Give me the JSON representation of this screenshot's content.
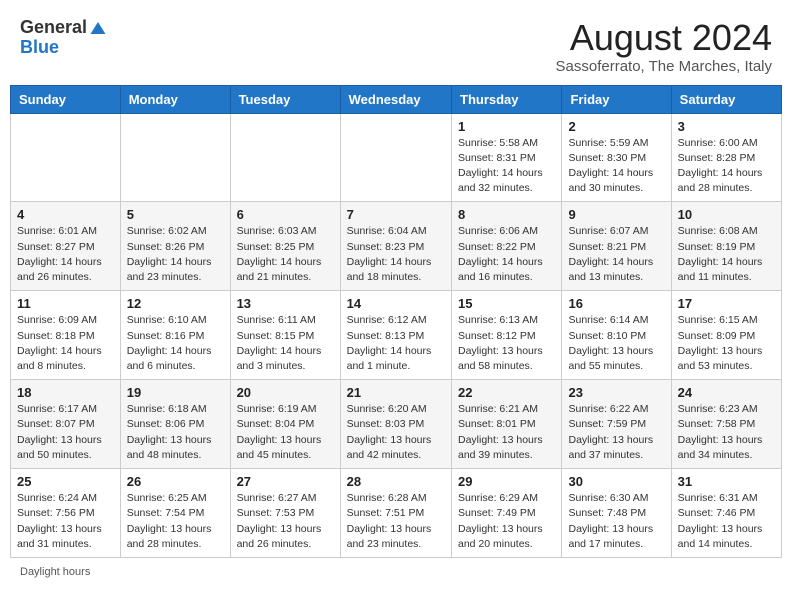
{
  "header": {
    "logo_general": "General",
    "logo_blue": "Blue",
    "month_title": "August 2024",
    "subtitle": "Sassoferrato, The Marches, Italy"
  },
  "days_of_week": [
    "Sunday",
    "Monday",
    "Tuesday",
    "Wednesday",
    "Thursday",
    "Friday",
    "Saturday"
  ],
  "weeks": [
    [
      {
        "day": "",
        "info": ""
      },
      {
        "day": "",
        "info": ""
      },
      {
        "day": "",
        "info": ""
      },
      {
        "day": "",
        "info": ""
      },
      {
        "day": "1",
        "info": "Sunrise: 5:58 AM\nSunset: 8:31 PM\nDaylight: 14 hours\nand 32 minutes."
      },
      {
        "day": "2",
        "info": "Sunrise: 5:59 AM\nSunset: 8:30 PM\nDaylight: 14 hours\nand 30 minutes."
      },
      {
        "day": "3",
        "info": "Sunrise: 6:00 AM\nSunset: 8:28 PM\nDaylight: 14 hours\nand 28 minutes."
      }
    ],
    [
      {
        "day": "4",
        "info": "Sunrise: 6:01 AM\nSunset: 8:27 PM\nDaylight: 14 hours\nand 26 minutes."
      },
      {
        "day": "5",
        "info": "Sunrise: 6:02 AM\nSunset: 8:26 PM\nDaylight: 14 hours\nand 23 minutes."
      },
      {
        "day": "6",
        "info": "Sunrise: 6:03 AM\nSunset: 8:25 PM\nDaylight: 14 hours\nand 21 minutes."
      },
      {
        "day": "7",
        "info": "Sunrise: 6:04 AM\nSunset: 8:23 PM\nDaylight: 14 hours\nand 18 minutes."
      },
      {
        "day": "8",
        "info": "Sunrise: 6:06 AM\nSunset: 8:22 PM\nDaylight: 14 hours\nand 16 minutes."
      },
      {
        "day": "9",
        "info": "Sunrise: 6:07 AM\nSunset: 8:21 PM\nDaylight: 14 hours\nand 13 minutes."
      },
      {
        "day": "10",
        "info": "Sunrise: 6:08 AM\nSunset: 8:19 PM\nDaylight: 14 hours\nand 11 minutes."
      }
    ],
    [
      {
        "day": "11",
        "info": "Sunrise: 6:09 AM\nSunset: 8:18 PM\nDaylight: 14 hours\nand 8 minutes."
      },
      {
        "day": "12",
        "info": "Sunrise: 6:10 AM\nSunset: 8:16 PM\nDaylight: 14 hours\nand 6 minutes."
      },
      {
        "day": "13",
        "info": "Sunrise: 6:11 AM\nSunset: 8:15 PM\nDaylight: 14 hours\nand 3 minutes."
      },
      {
        "day": "14",
        "info": "Sunrise: 6:12 AM\nSunset: 8:13 PM\nDaylight: 14 hours\nand 1 minute."
      },
      {
        "day": "15",
        "info": "Sunrise: 6:13 AM\nSunset: 8:12 PM\nDaylight: 13 hours\nand 58 minutes."
      },
      {
        "day": "16",
        "info": "Sunrise: 6:14 AM\nSunset: 8:10 PM\nDaylight: 13 hours\nand 55 minutes."
      },
      {
        "day": "17",
        "info": "Sunrise: 6:15 AM\nSunset: 8:09 PM\nDaylight: 13 hours\nand 53 minutes."
      }
    ],
    [
      {
        "day": "18",
        "info": "Sunrise: 6:17 AM\nSunset: 8:07 PM\nDaylight: 13 hours\nand 50 minutes."
      },
      {
        "day": "19",
        "info": "Sunrise: 6:18 AM\nSunset: 8:06 PM\nDaylight: 13 hours\nand 48 minutes."
      },
      {
        "day": "20",
        "info": "Sunrise: 6:19 AM\nSunset: 8:04 PM\nDaylight: 13 hours\nand 45 minutes."
      },
      {
        "day": "21",
        "info": "Sunrise: 6:20 AM\nSunset: 8:03 PM\nDaylight: 13 hours\nand 42 minutes."
      },
      {
        "day": "22",
        "info": "Sunrise: 6:21 AM\nSunset: 8:01 PM\nDaylight: 13 hours\nand 39 minutes."
      },
      {
        "day": "23",
        "info": "Sunrise: 6:22 AM\nSunset: 7:59 PM\nDaylight: 13 hours\nand 37 minutes."
      },
      {
        "day": "24",
        "info": "Sunrise: 6:23 AM\nSunset: 7:58 PM\nDaylight: 13 hours\nand 34 minutes."
      }
    ],
    [
      {
        "day": "25",
        "info": "Sunrise: 6:24 AM\nSunset: 7:56 PM\nDaylight: 13 hours\nand 31 minutes."
      },
      {
        "day": "26",
        "info": "Sunrise: 6:25 AM\nSunset: 7:54 PM\nDaylight: 13 hours\nand 28 minutes."
      },
      {
        "day": "27",
        "info": "Sunrise: 6:27 AM\nSunset: 7:53 PM\nDaylight: 13 hours\nand 26 minutes."
      },
      {
        "day": "28",
        "info": "Sunrise: 6:28 AM\nSunset: 7:51 PM\nDaylight: 13 hours\nand 23 minutes."
      },
      {
        "day": "29",
        "info": "Sunrise: 6:29 AM\nSunset: 7:49 PM\nDaylight: 13 hours\nand 20 minutes."
      },
      {
        "day": "30",
        "info": "Sunrise: 6:30 AM\nSunset: 7:48 PM\nDaylight: 13 hours\nand 17 minutes."
      },
      {
        "day": "31",
        "info": "Sunrise: 6:31 AM\nSunset: 7:46 PM\nDaylight: 13 hours\nand 14 minutes."
      }
    ]
  ],
  "footer": {
    "daylight_hours_label": "Daylight hours"
  }
}
